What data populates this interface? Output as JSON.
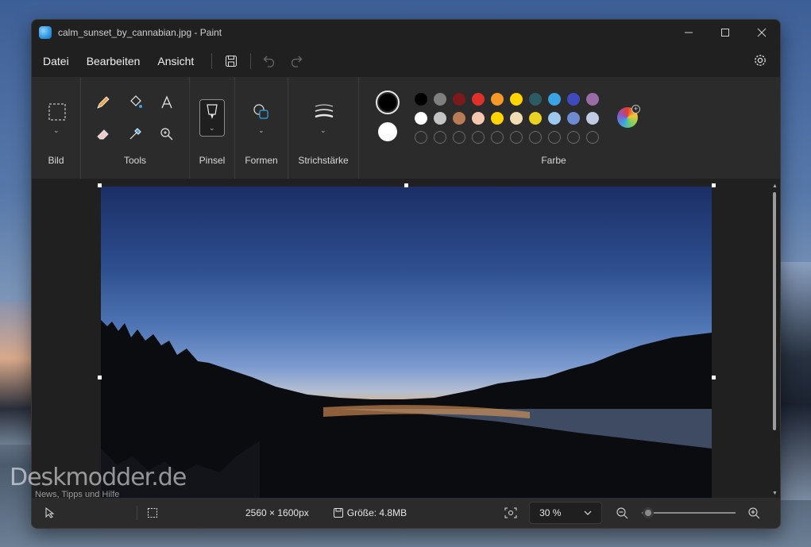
{
  "window": {
    "title": "calm_sunset_by_cannabian.jpg - Paint"
  },
  "menu": {
    "items": [
      "Datei",
      "Bearbeiten",
      "Ansicht"
    ]
  },
  "ribbon": {
    "groups": {
      "bild": "Bild",
      "tools": "Tools",
      "pinsel": "Pinsel",
      "formen": "Formen",
      "strichstaerke": "Strichstärke",
      "farbe": "Farbe"
    },
    "primary_color": "#000000",
    "secondary_color": "#ffffff",
    "palette_row1": [
      "#000000",
      "#7f7f7f",
      "#7a1a1a",
      "#e0302a",
      "#f59a27",
      "#ffd400",
      "#2e5a63",
      "#3aa3e3",
      "#3f4bbd",
      "#9a6ca5"
    ],
    "palette_row2": [
      "#ffffff",
      "#c4c4c4",
      "#b97b55",
      "#f6c8b0",
      "#ffd400",
      "#f2dcb4",
      "#e9d220",
      "#9ec8ef",
      "#6f8bd0",
      "#c0cbe4"
    ]
  },
  "status": {
    "dimensions": "2560 × 1600px",
    "size": "Größe: 4.8MB",
    "zoom": "30 %",
    "zoom_level_percent": 30
  },
  "watermark": {
    "title": "Deskmodder.de",
    "subtitle": "News, Tipps und Hilfe"
  }
}
